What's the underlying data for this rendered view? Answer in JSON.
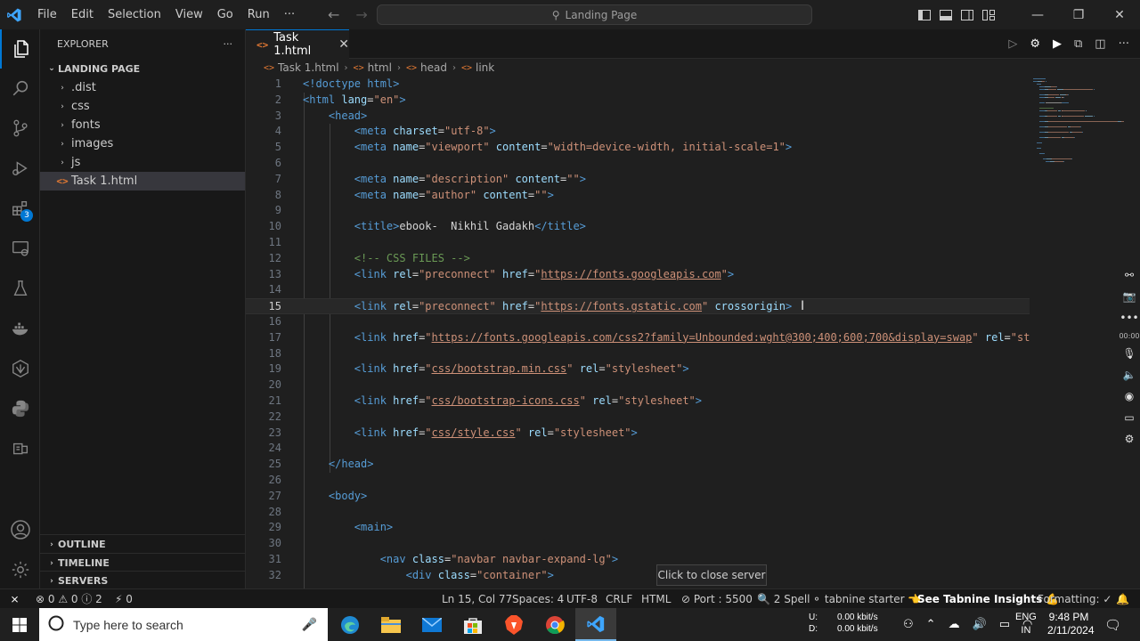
{
  "titlebar": {
    "menu": [
      "File",
      "Edit",
      "Selection",
      "View",
      "Go",
      "Run",
      "···"
    ],
    "search_text": "Landing Page"
  },
  "sidebar": {
    "title": "EXPLORER",
    "more": "···",
    "project": "LANDING PAGE",
    "items": [
      {
        "name": ".dist",
        "type": "folder"
      },
      {
        "name": "css",
        "type": "folder"
      },
      {
        "name": "fonts",
        "type": "folder"
      },
      {
        "name": "images",
        "type": "folder"
      },
      {
        "name": "js",
        "type": "folder"
      },
      {
        "name": "Task 1.html",
        "type": "file"
      }
    ],
    "sections": [
      "OUTLINE",
      "TIMELINE",
      "SERVERS"
    ]
  },
  "activity_badge": "3",
  "tab": {
    "label": "Task 1.html"
  },
  "breadcrumbs": [
    "Task 1.html",
    "html",
    "head",
    "link"
  ],
  "code": {
    "current_line": 15,
    "lines": [
      [
        [
          "<!doctype html>",
          "t-tag"
        ]
      ],
      [
        [
          "<html ",
          "t-tag"
        ],
        [
          "lang",
          "t-attr"
        ],
        [
          "=",
          "t-text"
        ],
        [
          "\"en\"",
          "t-str"
        ],
        [
          ">",
          "t-tag"
        ]
      ],
      [
        [
          "    <head>",
          "t-tag"
        ]
      ],
      [
        [
          "        <meta ",
          "t-tag"
        ],
        [
          "charset",
          "t-attr"
        ],
        [
          "=",
          "t-text"
        ],
        [
          "\"utf-8\"",
          "t-str"
        ],
        [
          ">",
          "t-tag"
        ]
      ],
      [
        [
          "        <meta ",
          "t-tag"
        ],
        [
          "name",
          "t-attr"
        ],
        [
          "=",
          "t-text"
        ],
        [
          "\"viewport\"",
          "t-str"
        ],
        [
          " content",
          "t-attr"
        ],
        [
          "=",
          "t-text"
        ],
        [
          "\"width=device-width, initial-scale=1\"",
          "t-str"
        ],
        [
          ">",
          "t-tag"
        ]
      ],
      [],
      [
        [
          "        <meta ",
          "t-tag"
        ],
        [
          "name",
          "t-attr"
        ],
        [
          "=",
          "t-text"
        ],
        [
          "\"description\"",
          "t-str"
        ],
        [
          " content",
          "t-attr"
        ],
        [
          "=",
          "t-text"
        ],
        [
          "\"\"",
          "t-str"
        ],
        [
          ">",
          "t-tag"
        ]
      ],
      [
        [
          "        <meta ",
          "t-tag"
        ],
        [
          "name",
          "t-attr"
        ],
        [
          "=",
          "t-text"
        ],
        [
          "\"author\"",
          "t-str"
        ],
        [
          " content",
          "t-attr"
        ],
        [
          "=",
          "t-text"
        ],
        [
          "\"\"",
          "t-str"
        ],
        [
          ">",
          "t-tag"
        ]
      ],
      [],
      [
        [
          "        <title>",
          "t-tag"
        ],
        [
          "ebook-  Nikhil Gadakh",
          "t-text"
        ],
        [
          "</title>",
          "t-tag"
        ]
      ],
      [],
      [
        [
          "        <!-- CSS FILES -->",
          "t-cmt"
        ]
      ],
      [
        [
          "        <link ",
          "t-tag"
        ],
        [
          "rel",
          "t-attr"
        ],
        [
          "=",
          "t-text"
        ],
        [
          "\"preconnect\"",
          "t-str"
        ],
        [
          " href",
          "t-attr"
        ],
        [
          "=",
          "t-text"
        ],
        [
          "\"",
          "t-str"
        ],
        [
          "https://fonts.googleapis.com",
          "t-str t-url"
        ],
        [
          "\"",
          "t-str"
        ],
        [
          ">",
          "t-tag"
        ]
      ],
      [],
      [
        [
          "        <link ",
          "t-tag"
        ],
        [
          "rel",
          "t-attr"
        ],
        [
          "=",
          "t-text"
        ],
        [
          "\"preconnect\"",
          "t-str"
        ],
        [
          " href",
          "t-attr"
        ],
        [
          "=",
          "t-text"
        ],
        [
          "\"",
          "t-str"
        ],
        [
          "https://fonts.gstatic.com",
          "t-str t-url"
        ],
        [
          "\"",
          "t-str"
        ],
        [
          " crossorigin",
          "t-attr"
        ],
        [
          ">",
          "t-tag"
        ]
      ],
      [],
      [
        [
          "        <link ",
          "t-tag"
        ],
        [
          "href",
          "t-attr"
        ],
        [
          "=",
          "t-text"
        ],
        [
          "\"",
          "t-str"
        ],
        [
          "https://fonts.googleapis.com/css2?family=Unbounded:wght@300;400;600;700&display=swap",
          "t-str t-url"
        ],
        [
          "\"",
          "t-str"
        ],
        [
          " rel",
          "t-attr"
        ],
        [
          "=",
          "t-text"
        ],
        [
          "\"st",
          "t-str"
        ]
      ],
      [],
      [
        [
          "        <link ",
          "t-tag"
        ],
        [
          "href",
          "t-attr"
        ],
        [
          "=",
          "t-text"
        ],
        [
          "\"",
          "t-str"
        ],
        [
          "css/bootstrap.min.css",
          "t-str t-url"
        ],
        [
          "\"",
          "t-str"
        ],
        [
          " rel",
          "t-attr"
        ],
        [
          "=",
          "t-text"
        ],
        [
          "\"stylesheet\"",
          "t-str"
        ],
        [
          ">",
          "t-tag"
        ]
      ],
      [],
      [
        [
          "        <link ",
          "t-tag"
        ],
        [
          "href",
          "t-attr"
        ],
        [
          "=",
          "t-text"
        ],
        [
          "\"",
          "t-str"
        ],
        [
          "css/bootstrap-icons.css",
          "t-str t-url"
        ],
        [
          "\"",
          "t-str"
        ],
        [
          " rel",
          "t-attr"
        ],
        [
          "=",
          "t-text"
        ],
        [
          "\"stylesheet\"",
          "t-str"
        ],
        [
          ">",
          "t-tag"
        ]
      ],
      [],
      [
        [
          "        <link ",
          "t-tag"
        ],
        [
          "href",
          "t-attr"
        ],
        [
          "=",
          "t-text"
        ],
        [
          "\"",
          "t-str"
        ],
        [
          "css/style.css",
          "t-str t-url"
        ],
        [
          "\"",
          "t-str"
        ],
        [
          " rel",
          "t-attr"
        ],
        [
          "=",
          "t-text"
        ],
        [
          "\"stylesheet\"",
          "t-str"
        ],
        [
          ">",
          "t-tag"
        ]
      ],
      [],
      [
        [
          "    </head>",
          "t-tag"
        ]
      ],
      [],
      [
        [
          "    <body>",
          "t-tag"
        ]
      ],
      [],
      [
        [
          "        <main>",
          "t-tag"
        ]
      ],
      [],
      [
        [
          "            <nav ",
          "t-tag"
        ],
        [
          "class",
          "t-attr"
        ],
        [
          "=",
          "t-text"
        ],
        [
          "\"navbar navbar-expand-lg\"",
          "t-str"
        ],
        [
          ">",
          "t-tag"
        ]
      ],
      [
        [
          "                <div ",
          "t-tag"
        ],
        [
          "class",
          "t-attr"
        ],
        [
          "=",
          "t-text"
        ],
        [
          "\"container\"",
          "t-str"
        ],
        [
          ">",
          "t-tag"
        ]
      ]
    ]
  },
  "tooltip": "Click to close server",
  "statusbar": {
    "problems": "⊗ 0 ⚠ 0 ⓘ 2",
    "ports": "⚡ 0",
    "position": "Ln 15, Col 77",
    "spaces": "Spaces: 4",
    "encoding": "UTF-8",
    "eol": "CRLF",
    "language": "HTML",
    "port": "⊘ Port : 5500",
    "spell": "🔍 2 Spell",
    "tabnine": "⚬ tabnine starter 👈",
    "insights": "See Tabnine Insights 💪",
    "formatting": "Formatting: ✓"
  },
  "floatbar": {
    "time": "00:00"
  },
  "taskbar": {
    "search_placeholder": "Type here to search",
    "net_up": "U:",
    "net_down": "D:",
    "net_up_val": "0.00 kbit/s",
    "net_down_val": "0.00 kbit/s",
    "lang1": "ENG",
    "lang2": "IN",
    "time": "9:48 PM",
    "date": "2/11/2024"
  },
  "colors": {
    "accent": "#0078d4",
    "html_icon": "#e37933"
  }
}
